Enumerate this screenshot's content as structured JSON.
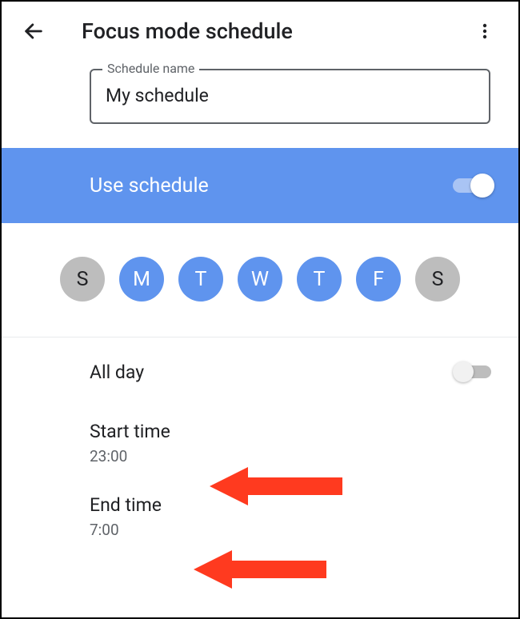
{
  "header": {
    "title": "Focus mode schedule"
  },
  "schedule_name": {
    "label": "Schedule name",
    "value": "My schedule"
  },
  "use_schedule": {
    "label": "Use schedule",
    "enabled": true
  },
  "days": [
    {
      "letter": "S",
      "selected": false
    },
    {
      "letter": "M",
      "selected": true
    },
    {
      "letter": "T",
      "selected": true
    },
    {
      "letter": "W",
      "selected": true
    },
    {
      "letter": "T",
      "selected": true
    },
    {
      "letter": "F",
      "selected": true
    },
    {
      "letter": "S",
      "selected": false
    }
  ],
  "all_day": {
    "label": "All day",
    "enabled": false
  },
  "start_time": {
    "label": "Start time",
    "value": "23:00"
  },
  "end_time": {
    "label": "End time",
    "value": "7:00"
  },
  "annotation": {
    "arrow_color": "#ff3a1f"
  }
}
